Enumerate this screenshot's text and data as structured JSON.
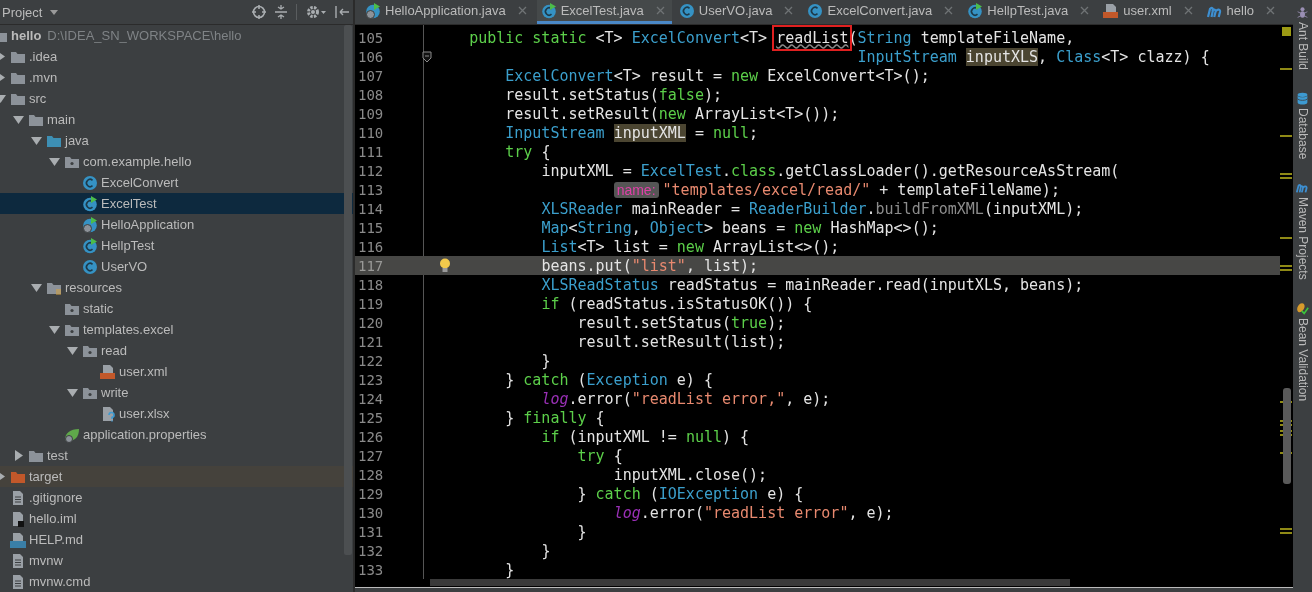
{
  "project_panel": {
    "title": "Project",
    "tree": [
      {
        "label": "hello",
        "path": "D:\\IDEA_SN_WORKSPACE\\hello",
        "kind": "module",
        "selected": false,
        "children": [
          {
            "label": ".idea",
            "kind": "folder",
            "selected": false,
            "expanded": false
          },
          {
            "label": ".mvn",
            "kind": "folder",
            "selected": false,
            "expanded": false
          },
          {
            "label": "src",
            "kind": "folder",
            "selected": false,
            "expanded": true,
            "children": [
              {
                "label": "main",
                "kind": "folder",
                "selected": false,
                "expanded": true,
                "children": [
                  {
                    "label": "java",
                    "kind": "src-folder",
                    "selected": false,
                    "expanded": true,
                    "children": [
                      {
                        "label": "com.example.hello",
                        "kind": "package",
                        "selected": false,
                        "expanded": true,
                        "children": [
                          {
                            "label": "ExcelConvert",
                            "kind": "class",
                            "selected": false
                          },
                          {
                            "label": "ExcelTest",
                            "kind": "class-run",
                            "selected": true
                          },
                          {
                            "label": "HelloApplication",
                            "kind": "class-spring",
                            "selected": false
                          },
                          {
                            "label": "HellpTest",
                            "kind": "class-run",
                            "selected": false
                          },
                          {
                            "label": "UserVO",
                            "kind": "class",
                            "selected": false
                          }
                        ]
                      }
                    ]
                  },
                  {
                    "label": "resources",
                    "kind": "resources",
                    "selected": false,
                    "expanded": true,
                    "children": [
                      {
                        "label": "static",
                        "kind": "package",
                        "selected": false
                      },
                      {
                        "label": "templates.excel",
                        "kind": "package",
                        "selected": false,
                        "expanded": true,
                        "children": [
                          {
                            "label": "read",
                            "kind": "package",
                            "selected": false,
                            "expanded": true,
                            "children": [
                              {
                                "label": "user.xml",
                                "kind": "xml",
                                "selected": false
                              }
                            ]
                          },
                          {
                            "label": "write",
                            "kind": "package",
                            "selected": false,
                            "expanded": true,
                            "children": [
                              {
                                "label": "user.xlsx",
                                "kind": "xlsx",
                                "selected": false
                              }
                            ]
                          }
                        ]
                      },
                      {
                        "label": "application.properties",
                        "kind": "props",
                        "selected": false
                      }
                    ]
                  }
                ]
              },
              {
                "label": "test",
                "kind": "folder",
                "selected": false,
                "expanded": false
              }
            ]
          },
          {
            "label": "target",
            "kind": "excluded",
            "selected": false,
            "expanded": false
          },
          {
            "label": ".gitignore",
            "kind": "file",
            "selected": false
          },
          {
            "label": "hello.iml",
            "kind": "iml",
            "selected": false
          },
          {
            "label": "HELP.md",
            "kind": "md",
            "selected": false
          },
          {
            "label": "mvnw",
            "kind": "file",
            "selected": false
          },
          {
            "label": "mvnw.cmd",
            "kind": "file",
            "selected": false
          }
        ]
      }
    ]
  },
  "editor": {
    "tabs": [
      {
        "label": "HelloApplication.java",
        "kind": "class-spring",
        "selected": false
      },
      {
        "label": "ExcelTest.java",
        "kind": "class-run",
        "selected": true
      },
      {
        "label": "UserVO.java",
        "kind": "class",
        "selected": false
      },
      {
        "label": "ExcelConvert.java",
        "kind": "class",
        "selected": false
      },
      {
        "label": "HellpTest.java",
        "kind": "class-run",
        "selected": false
      },
      {
        "label": "user.xml",
        "kind": "xml",
        "selected": false
      },
      {
        "label": "hello",
        "kind": "maven",
        "selected": false
      }
    ],
    "lines": [
      {
        "number": "105",
        "current": false,
        "tokens": [
          {
            "kind": "keyword",
            "text": "    public"
          },
          {
            "kind": "keyword",
            "text": " static"
          },
          {
            "kind": "plain",
            "text": " <T>"
          },
          {
            "kind": "type",
            "text": " ExcelConvert"
          },
          {
            "kind": "plain",
            "text": "<T>"
          },
          {
            "kind": "annotated",
            "text": " readList"
          },
          {
            "kind": "plain",
            "text": "("
          },
          {
            "kind": "type",
            "text": "String"
          },
          {
            "kind": "plain",
            "text": " templateFileName,"
          }
        ]
      },
      {
        "number": "106",
        "current": false,
        "tokens": [
          {
            "kind": "type",
            "text": "                                               InputStream"
          },
          {
            "kind": "highlight",
            "text": " inputXLS"
          },
          {
            "kind": "plain",
            "text": ","
          },
          {
            "kind": "type",
            "text": " Class"
          },
          {
            "kind": "plain",
            "text": "<T> clazz) {"
          }
        ]
      },
      {
        "number": "107",
        "current": false,
        "tokens": [
          {
            "kind": "type",
            "text": "        ExcelConvert"
          },
          {
            "kind": "plain",
            "text": "<T> result ="
          },
          {
            "kind": "keyword",
            "text": " new"
          },
          {
            "kind": "plain",
            "text": " ExcelConvert<T>();"
          }
        ]
      },
      {
        "number": "108",
        "current": false,
        "tokens": [
          {
            "kind": "plain",
            "text": "        result.setStatus("
          },
          {
            "kind": "keyword",
            "text": "false"
          },
          {
            "kind": "plain",
            "text": ");"
          }
        ]
      },
      {
        "number": "109",
        "current": false,
        "tokens": [
          {
            "kind": "plain",
            "text": "        result.setResult("
          },
          {
            "kind": "keyword",
            "text": "new"
          },
          {
            "kind": "plain",
            "text": " ArrayList<T>());"
          }
        ]
      },
      {
        "number": "110",
        "current": false,
        "tokens": [
          {
            "kind": "type",
            "text": "        InputStream"
          },
          {
            "kind": "highlight",
            "text": " inputXML"
          },
          {
            "kind": "plain",
            "text": " ="
          },
          {
            "kind": "keyword",
            "text": " null"
          },
          {
            "kind": "plain",
            "text": ";"
          }
        ]
      },
      {
        "number": "111",
        "current": false,
        "tokens": [
          {
            "kind": "keyword",
            "text": "        try"
          },
          {
            "kind": "plain",
            "text": " {"
          }
        ]
      },
      {
        "number": "112",
        "current": false,
        "tokens": [
          {
            "kind": "plain",
            "text": "            inputXML ="
          },
          {
            "kind": "type",
            "text": " ExcelTest"
          },
          {
            "kind": "plain",
            "text": "."
          },
          {
            "kind": "keyword",
            "text": "class"
          },
          {
            "kind": "plain",
            "text": ".getClassLoader().getResourceAsStream("
          }
        ]
      },
      {
        "number": "113",
        "current": false,
        "tokens": [
          {
            "kind": "hint",
            "text": "                    name:"
          },
          {
            "kind": "string",
            "text": "\"templates/excel/read/\""
          },
          {
            "kind": "plain",
            "text": " + templateFileName);"
          }
        ]
      },
      {
        "number": "114",
        "current": false,
        "tokens": [
          {
            "kind": "type",
            "text": "            XLSReader"
          },
          {
            "kind": "plain",
            "text": " mainReader ="
          },
          {
            "kind": "type",
            "text": " ReaderBuilder"
          },
          {
            "kind": "plain",
            "text": "."
          },
          {
            "kind": "dim",
            "text": "buildFromXML"
          },
          {
            "kind": "plain",
            "text": "(inputXML);"
          }
        ]
      },
      {
        "number": "115",
        "current": false,
        "tokens": [
          {
            "kind": "type",
            "text": "            Map"
          },
          {
            "kind": "plain",
            "text": "<"
          },
          {
            "kind": "type",
            "text": "String"
          },
          {
            "kind": "plain",
            "text": ","
          },
          {
            "kind": "type",
            "text": " Object"
          },
          {
            "kind": "plain",
            "text": "> beans ="
          },
          {
            "kind": "keyword",
            "text": " new"
          },
          {
            "kind": "plain",
            "text": " HashMap<>();"
          }
        ]
      },
      {
        "number": "116",
        "current": false,
        "tokens": [
          {
            "kind": "type",
            "text": "            List"
          },
          {
            "kind": "plain",
            "text": "<T> list ="
          },
          {
            "kind": "keyword",
            "text": " new"
          },
          {
            "kind": "plain",
            "text": " ArrayList<>();"
          }
        ]
      },
      {
        "number": "117",
        "current": true,
        "tokens": [
          {
            "kind": "plain",
            "text": "            beans.put("
          },
          {
            "kind": "string",
            "text": "\"list\""
          },
          {
            "kind": "plain",
            "text": ", list);"
          }
        ]
      },
      {
        "number": "118",
        "current": false,
        "tokens": [
          {
            "kind": "type",
            "text": "            XLSReadStatus"
          },
          {
            "kind": "plain",
            "text": " readStatus = mainReader.read(inputXLS, beans);"
          }
        ]
      },
      {
        "number": "119",
        "current": false,
        "tokens": [
          {
            "kind": "keyword",
            "text": "            if"
          },
          {
            "kind": "plain",
            "text": " (readStatus.isStatusOK()) {"
          }
        ]
      },
      {
        "number": "120",
        "current": false,
        "tokens": [
          {
            "kind": "plain",
            "text": "                result.setStatus("
          },
          {
            "kind": "keyword",
            "text": "true"
          },
          {
            "kind": "plain",
            "text": ");"
          }
        ]
      },
      {
        "number": "121",
        "current": false,
        "tokens": [
          {
            "kind": "plain",
            "text": "                result.setResult(list);"
          }
        ]
      },
      {
        "number": "122",
        "current": false,
        "tokens": [
          {
            "kind": "plain",
            "text": "            }"
          }
        ]
      },
      {
        "number": "123",
        "current": false,
        "tokens": [
          {
            "kind": "plain",
            "text": "        }"
          },
          {
            "kind": "keyword",
            "text": " catch"
          },
          {
            "kind": "plain",
            "text": " ("
          },
          {
            "kind": "type",
            "text": "Exception"
          },
          {
            "kind": "plain",
            "text": " e) {"
          }
        ]
      },
      {
        "number": "124",
        "current": false,
        "tokens": [
          {
            "kind": "static-field",
            "text": "            log"
          },
          {
            "kind": "plain",
            "text": ".error("
          },
          {
            "kind": "string",
            "text": "\"readList error,\""
          },
          {
            "kind": "plain",
            "text": ", e);"
          }
        ]
      },
      {
        "number": "125",
        "current": false,
        "tokens": [
          {
            "kind": "plain",
            "text": "        }"
          },
          {
            "kind": "keyword",
            "text": " finally"
          },
          {
            "kind": "plain",
            "text": " {"
          }
        ]
      },
      {
        "number": "126",
        "current": false,
        "tokens": [
          {
            "kind": "keyword",
            "text": "            if"
          },
          {
            "kind": "plain",
            "text": " (inputXML !="
          },
          {
            "kind": "keyword",
            "text": " null"
          },
          {
            "kind": "plain",
            "text": ") {"
          }
        ]
      },
      {
        "number": "127",
        "current": false,
        "tokens": [
          {
            "kind": "keyword",
            "text": "                try"
          },
          {
            "kind": "plain",
            "text": " {"
          }
        ]
      },
      {
        "number": "128",
        "current": false,
        "tokens": [
          {
            "kind": "plain",
            "text": "                    inputXML.close();"
          }
        ]
      },
      {
        "number": "129",
        "current": false,
        "tokens": [
          {
            "kind": "plain",
            "text": "                }"
          },
          {
            "kind": "keyword",
            "text": " catch"
          },
          {
            "kind": "plain",
            "text": " ("
          },
          {
            "kind": "type",
            "text": "IOException"
          },
          {
            "kind": "plain",
            "text": " e) {"
          }
        ]
      },
      {
        "number": "130",
        "current": false,
        "tokens": [
          {
            "kind": "static-field",
            "text": "                    log"
          },
          {
            "kind": "plain",
            "text": ".error("
          },
          {
            "kind": "string",
            "text": "\"readList error\""
          },
          {
            "kind": "plain",
            "text": ", e);"
          }
        ]
      },
      {
        "number": "131",
        "current": false,
        "tokens": [
          {
            "kind": "plain",
            "text": "                }"
          }
        ]
      },
      {
        "number": "132",
        "current": false,
        "tokens": [
          {
            "kind": "plain",
            "text": "            }"
          }
        ]
      },
      {
        "number": "133",
        "current": false,
        "tokens": [
          {
            "kind": "plain",
            "text": "        }"
          }
        ]
      }
    ]
  },
  "tool_windows": [
    {
      "label": "Ant Build",
      "kind": "ant"
    },
    {
      "label": "Database",
      "kind": "database"
    },
    {
      "label": "Maven Projects",
      "kind": "maven"
    },
    {
      "label": "Bean Validation",
      "kind": "bean"
    }
  ]
}
